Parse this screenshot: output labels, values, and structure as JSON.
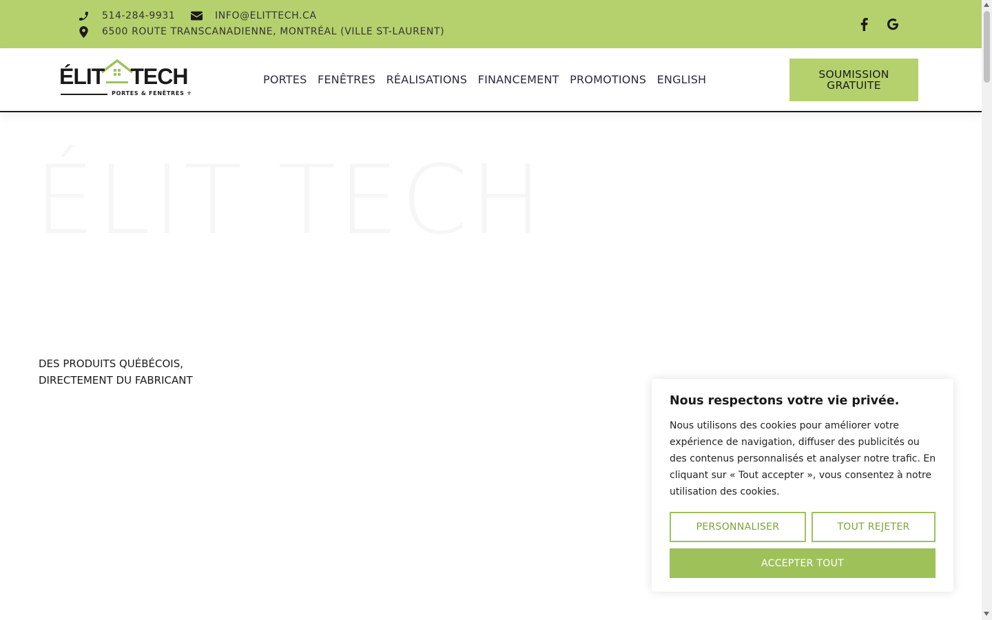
{
  "topbar": {
    "phone": "514-284-9931",
    "email": "INFO@ELITTECH.CA",
    "address": "6500 ROUTE TRANSCANADIENNE, MONTRÉAL (VILLE ST-LAURENT)",
    "phone_icon": "phone-icon",
    "email_icon": "envelope-icon",
    "address_icon": "map-pin-icon",
    "social": [
      "facebook-icon",
      "google-icon"
    ],
    "background": "#b5d16d"
  },
  "header": {
    "logo": {
      "left": "ÉLIT",
      "right": "TECH",
      "tagline": "PORTES & FENÊTRES ⚜"
    },
    "nav": [
      "PORTES",
      "FENÊTRES",
      "RÉALISATIONS",
      "FINANCEMENT",
      "PROMOTIONS",
      "ENGLISH"
    ],
    "cta": {
      "line1": "SOUMISSION",
      "line2": "GRATUITE"
    }
  },
  "hero": {
    "title": "ÉLIT TECH",
    "subtitle_line1": "DES PRODUITS QUÉBÉCOIS,",
    "subtitle_line2": "DIRECTEMENT DU FABRICANT"
  },
  "cookie": {
    "title": "Nous respectons votre vie privée.",
    "body": "Nous utilisons des cookies pour améliorer votre expérience de navigation, diffuser des publicités ou des contenus personnalisés et analyser notre trafic. En cliquant sur « Tout accepter », vous consentez à notre utilisation des cookies.",
    "customize": "PERSONNALISER",
    "reject": "TOUT REJETER",
    "accept": "ACCEPTER TOUT",
    "accent": "#9fc15a"
  }
}
